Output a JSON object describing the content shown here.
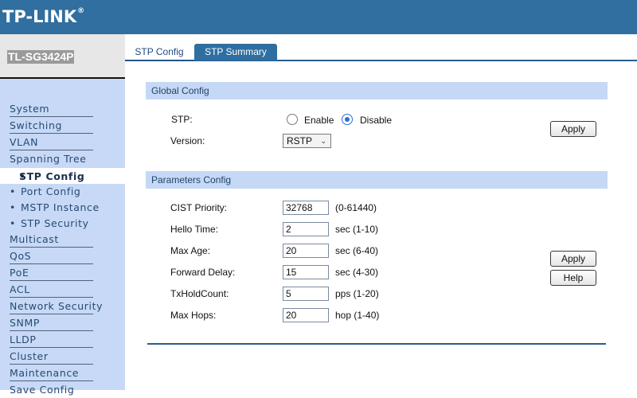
{
  "header": {
    "brand": "TP-LINK",
    "reg_mark": "®"
  },
  "device": {
    "model": "TL-SG3424P"
  },
  "tabs": [
    {
      "label": "STP Config",
      "active": true
    },
    {
      "label": "STP Summary",
      "active": false
    }
  ],
  "sidebar": {
    "items": [
      {
        "label": "System"
      },
      {
        "label": "Switching"
      },
      {
        "label": "VLAN"
      },
      {
        "label": "Spanning Tree"
      },
      {
        "label": "STP Config",
        "active": true
      },
      {
        "label": "Port Config"
      },
      {
        "label": "MSTP Instance"
      },
      {
        "label": "STP Security"
      },
      {
        "label": "Multicast"
      },
      {
        "label": "QoS"
      },
      {
        "label": "PoE"
      },
      {
        "label": "ACL"
      },
      {
        "label": "Network Security"
      },
      {
        "label": "SNMP"
      },
      {
        "label": "LLDP"
      },
      {
        "label": "Cluster"
      },
      {
        "label": "Maintenance"
      },
      {
        "label": "Save Config"
      }
    ],
    "bullet": "•"
  },
  "global_config": {
    "title": "Global Config",
    "stp_label": "STP:",
    "enable_label": "Enable",
    "disable_label": "Disable",
    "stp_selected": "Disable",
    "version_label": "Version:",
    "version_value": "RSTP",
    "apply_label": "Apply"
  },
  "parameters_config": {
    "title": "Parameters Config",
    "fields": [
      {
        "label": "CIST Priority:",
        "value": "32768",
        "unit": "(0-61440)"
      },
      {
        "label": "Hello Time:",
        "value": "2",
        "unit": "sec (1-10)"
      },
      {
        "label": "Max Age:",
        "value": "20",
        "unit": "sec (6-40)"
      },
      {
        "label": "Forward Delay:",
        "value": "15",
        "unit": "sec (4-30)"
      },
      {
        "label": "TxHoldCount:",
        "value": "5",
        "unit": "pps (1-20)"
      },
      {
        "label": "Max Hops:",
        "value": "20",
        "unit": "hop (1-40)"
      }
    ],
    "apply_label": "Apply",
    "help_label": "Help"
  },
  "colors": {
    "header": "#306f9f",
    "sidebar": "#c7d9f6",
    "section_bar": "#c5d8f5",
    "tab_inactive": "#2f6ea1",
    "radio_selected": "#2a6fd6"
  }
}
